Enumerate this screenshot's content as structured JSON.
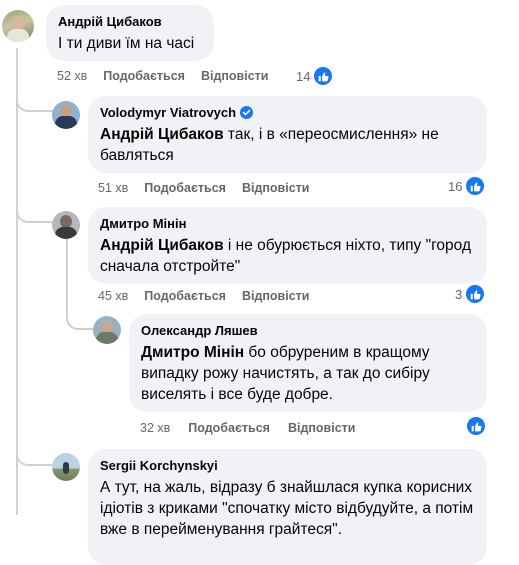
{
  "comments": [
    {
      "author": "Андрій Цибаков",
      "text": "І ти диви їм на часі",
      "time": "52 хв",
      "like_label": "Подобається",
      "reply_label": "Відповісти",
      "reactions": "14"
    },
    {
      "author": "Volodymyr Viatrovych",
      "verified": true,
      "mention": "Андрій Цибаков",
      "text": " так, і в «переосмислення» не бавляться",
      "time": "51 хв",
      "like_label": "Подобається",
      "reply_label": "Відповісти",
      "reactions": "16"
    },
    {
      "author": "Дмитро Мінін",
      "mention": "Андрій Цибаков",
      "text": " і не обурюється ніхто, типу \"город сначала отстройте\"",
      "time": "45 хв",
      "like_label": "Подобається",
      "reply_label": "Відповісти",
      "reactions": "3"
    },
    {
      "author": "Олександр Ляшев",
      "mention": "Дмитро Мінін",
      "text": " бо обруреним в кращому випадку рожу начистять, а так до сибіру виселять і все буде добре.",
      "time": "32 хв",
      "like_label": "Подобається",
      "reply_label": "Відповісти"
    },
    {
      "author": "Sergii Korchynskyi",
      "text": "А тут, на жаль, відразу б знайшлася купка корисних ідіотів з криками \"спочатку місто відбудуйте, а потім вже в перейменування грайтеся\"."
    }
  ],
  "icons": {
    "like": "thumbs-up-icon",
    "verified": "verified-badge-icon"
  },
  "colors": {
    "bubble": "#f0f2f5",
    "accent": "#1877f2",
    "meta": "#65676b"
  }
}
